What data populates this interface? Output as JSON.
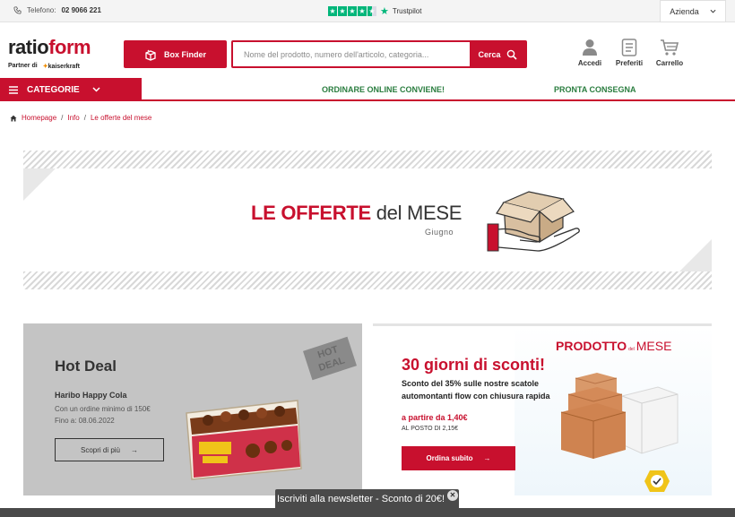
{
  "topbar": {
    "phone_label": "Telefono:",
    "phone_number": "02 9066 221",
    "trustpilot_label": "Trustpilot",
    "trustpilot_rating": 4.5,
    "company_select": "Azienda"
  },
  "header": {
    "logo_main_a": "ratio",
    "logo_main_b": "form",
    "logo_partner": "Partner di",
    "logo_partner_brand": "kaiserkraft",
    "box_finder_label": "Box Finder",
    "search_placeholder": "Nome del prodotto, numero dell'articolo, categoria...",
    "search_button": "Cerca",
    "login_label": "Accedi",
    "favorites_label": "Preferiti",
    "cart_label": "Carrello"
  },
  "nav": {
    "categories_label": "CATEGORIE",
    "link_1": "ORDINARE ONLINE CONVIENE!",
    "link_2": "PRONTA CONSEGNA"
  },
  "breadcrumb": {
    "home": "Homepage",
    "info": "Info",
    "current": "Le offerte del mese"
  },
  "banner": {
    "title_red": "LE OFFERTE",
    "title_dark": "del MESE",
    "month": "Giugno"
  },
  "hot_deal": {
    "title": "Hot Deal",
    "badge_line_1": "HOT",
    "badge_line_2": "DEAL",
    "product": "Haribo Happy Cola",
    "min_order": "Con un ordine minimo di 150€",
    "valid_until": "Fino a: 08.06.2022",
    "button": "Scopri di più",
    "arrow": "→"
  },
  "product_of_month": {
    "head_a": "PRODOTTO",
    "head_del": "del",
    "head_b": "MESE",
    "title": "30 giorni di sconti!",
    "description": "Sconto del 35% sulle nostre scatole automontanti flow con chiusura rapida",
    "price": "a partire da 1,40€",
    "price_original": "AL POSTO DI 2,15€",
    "button": "Ordina subito",
    "arrow": "→"
  },
  "newsletter": {
    "label": "Iscriviti alla newsletter - Sconto di 20€!"
  },
  "colors": {
    "brand_red": "#c8102e",
    "nav_green": "#2a7d3f",
    "trustpilot_green": "#00b67a"
  }
}
